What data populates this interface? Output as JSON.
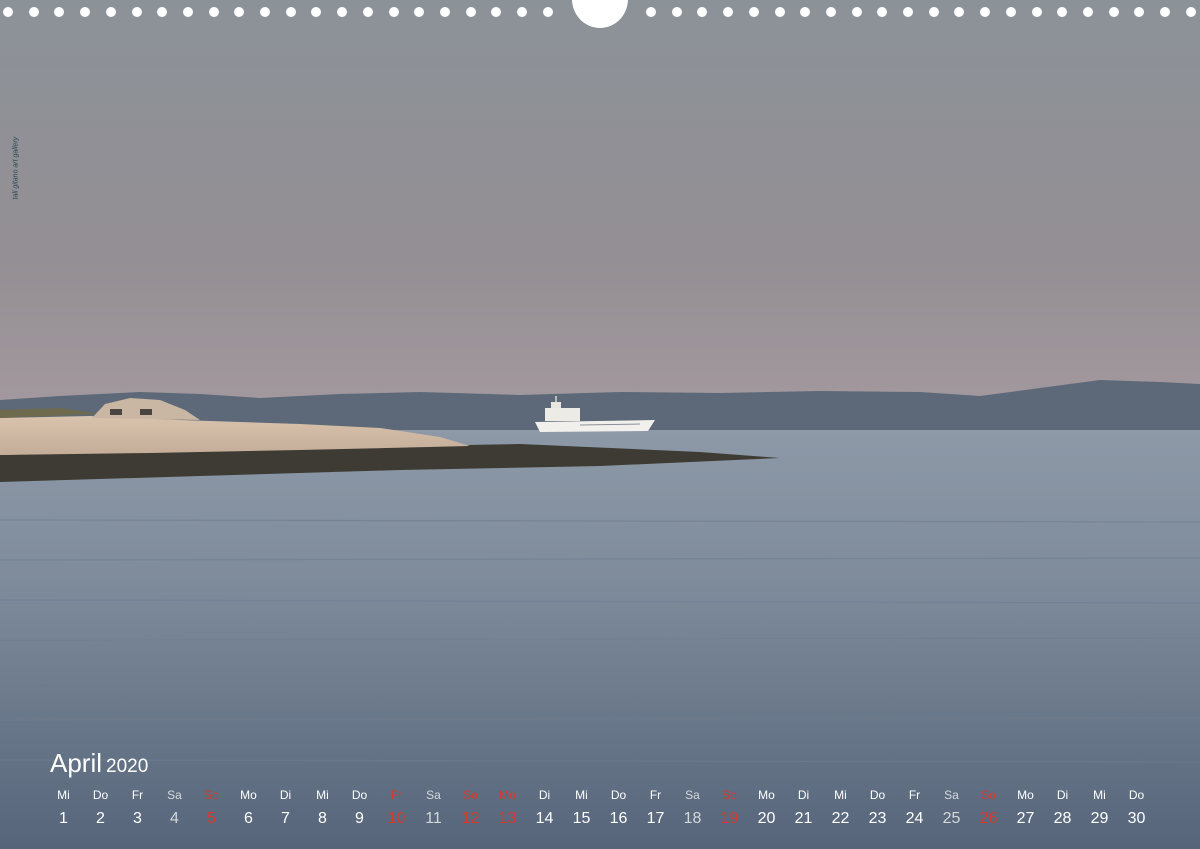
{
  "calendar": {
    "month": "April",
    "year": "2020",
    "days": [
      {
        "name": "Mi",
        "num": "1",
        "type": "weekday"
      },
      {
        "name": "Do",
        "num": "2",
        "type": "weekday"
      },
      {
        "name": "Fr",
        "num": "3",
        "type": "weekday"
      },
      {
        "name": "Sa",
        "num": "4",
        "type": "saturday"
      },
      {
        "name": "So",
        "num": "5",
        "type": "sunday"
      },
      {
        "name": "Mo",
        "num": "6",
        "type": "weekday"
      },
      {
        "name": "Di",
        "num": "7",
        "type": "weekday"
      },
      {
        "name": "Mi",
        "num": "8",
        "type": "weekday"
      },
      {
        "name": "Do",
        "num": "9",
        "type": "weekday"
      },
      {
        "name": "Fr",
        "num": "10",
        "type": "holiday"
      },
      {
        "name": "Sa",
        "num": "11",
        "type": "saturday"
      },
      {
        "name": "So",
        "num": "12",
        "type": "sunday"
      },
      {
        "name": "Mo",
        "num": "13",
        "type": "holiday"
      },
      {
        "name": "Di",
        "num": "14",
        "type": "weekday"
      },
      {
        "name": "Mi",
        "num": "15",
        "type": "weekday"
      },
      {
        "name": "Do",
        "num": "16",
        "type": "weekday"
      },
      {
        "name": "Fr",
        "num": "17",
        "type": "weekday"
      },
      {
        "name": "Sa",
        "num": "18",
        "type": "saturday"
      },
      {
        "name": "So",
        "num": "19",
        "type": "sunday"
      },
      {
        "name": "Mo",
        "num": "20",
        "type": "weekday"
      },
      {
        "name": "Di",
        "num": "21",
        "type": "weekday"
      },
      {
        "name": "Mi",
        "num": "22",
        "type": "weekday"
      },
      {
        "name": "Do",
        "num": "23",
        "type": "weekday"
      },
      {
        "name": "Fr",
        "num": "24",
        "type": "weekday"
      },
      {
        "name": "Sa",
        "num": "25",
        "type": "saturday"
      },
      {
        "name": "So",
        "num": "26",
        "type": "sunday"
      },
      {
        "name": "Mo",
        "num": "27",
        "type": "weekday"
      },
      {
        "name": "Di",
        "num": "28",
        "type": "weekday"
      },
      {
        "name": "Mi",
        "num": "29",
        "type": "weekday"
      },
      {
        "name": "Do",
        "num": "30",
        "type": "weekday"
      }
    ]
  },
  "watermark": {
    "text": "tali gitano art gallery"
  },
  "colors": {
    "sunday": "#d63a2f",
    "text": "#ffffff",
    "saturday": "#d5d8db"
  }
}
